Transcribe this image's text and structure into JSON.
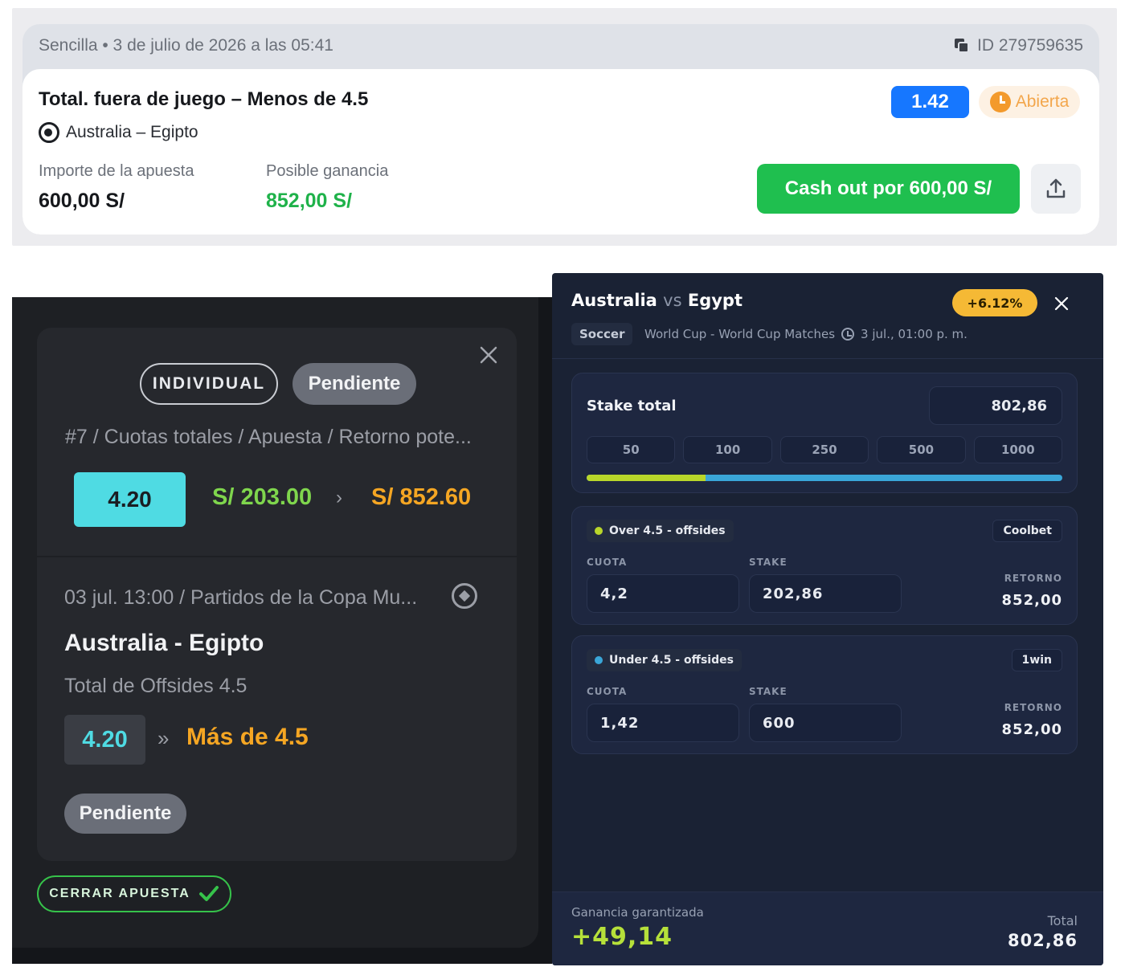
{
  "bet_card": {
    "header_left": "Sencilla • 3 de julio de 2026 a las 05:41",
    "header_id": "ID 279759635",
    "market": "Total. fuera de juego – Menos de 4.5",
    "event": "Australia – Egipto",
    "odds": "1.42",
    "status": "Abierta",
    "stake_label": "Importe de la apuesta",
    "stake_value": "600,00 S/",
    "win_label": "Posible ganancia",
    "win_value": "852,00 S/",
    "cashout_label": "Cash out por 600,00 S/",
    "colors": {
      "odds_bg": "#1677ff",
      "cashout_bg": "#1fbf4f",
      "win_text": "#1fb24a",
      "status_text": "#f3a64b"
    }
  },
  "dark_slip": {
    "type_pill": "INDIVIDUAL",
    "status_pill": "Pendiente",
    "columns_path": "#7 / Cuotas totales / Apuesta / Retorno pote...",
    "total_odds": "4.20",
    "stake": "S/ 203.00",
    "arrow": "›",
    "potential_return": "S/ 852.60",
    "meta": "03 jul. 13:00  /  Partidos de la Copa Mu...",
    "teams": "Australia - Egipto",
    "market": "Total de Offsides 4.5",
    "selection_odds": "4.20",
    "double_arrow": "»",
    "selection": "Más de 4.5",
    "selection_status": "Pendiente",
    "close_bet_label": "CERRAR APUESTA",
    "colors": {
      "teal": "#4fdbe3",
      "green": "#7fd64d",
      "orange": "#f5a623"
    }
  },
  "calculator": {
    "home": "Australia",
    "vs": "vs",
    "away": "Egypt",
    "profit_badge": "+6.12%",
    "sport": "Soccer",
    "competition": "World Cup - World Cup Matches",
    "datetime": "3 jul., 01:00 p. m.",
    "stake_total_label": "Stake total",
    "stake_total_value": "802,86",
    "quick_chips": [
      "50",
      "100",
      "250",
      "500",
      "1000"
    ],
    "split_fraction": 0.25,
    "legs": [
      {
        "label": "Over 4.5 - offsides",
        "dot_color": "#b9d62a",
        "bookmaker": "Coolbet",
        "odds_caption": "CUOTA",
        "odds": "4,2",
        "stake_caption": "STAKE",
        "stake": "202,86",
        "return_caption": "RETORNO",
        "return": "852,00"
      },
      {
        "label": "Under 4.5 - offsides",
        "dot_color": "#3aa6d8",
        "bookmaker": "1win",
        "odds_caption": "CUOTA",
        "odds": "1,42",
        "stake_caption": "STAKE",
        "stake": "600",
        "return_caption": "RETORNO",
        "return": "852,00"
      }
    ],
    "guaranteed_label": "Ganancia garantizada",
    "guaranteed_value": "+49,14",
    "total_label": "Total",
    "total_value": "802,86"
  }
}
